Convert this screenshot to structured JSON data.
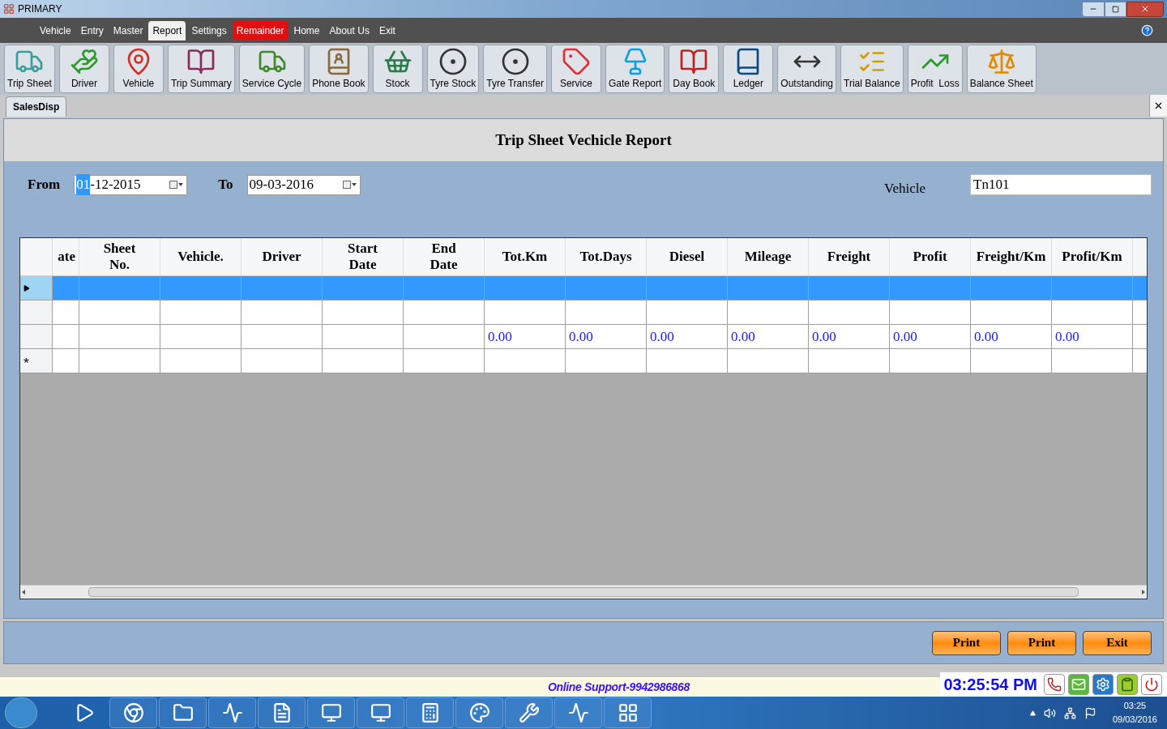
{
  "window": {
    "title": "PRIMARY"
  },
  "menu": [
    {
      "label": "Vehicle",
      "selected": false,
      "kind": "normal"
    },
    {
      "label": "Entry",
      "selected": false,
      "kind": "normal"
    },
    {
      "label": "Master",
      "selected": false,
      "kind": "normal"
    },
    {
      "label": "Report",
      "selected": true,
      "kind": "normal"
    },
    {
      "label": "Settings",
      "selected": false,
      "kind": "normal"
    },
    {
      "label": "Remainder",
      "selected": false,
      "kind": "alert"
    },
    {
      "label": "Home",
      "selected": false,
      "kind": "normal"
    },
    {
      "label": "About Us",
      "selected": false,
      "kind": "normal"
    },
    {
      "label": "Exit",
      "selected": false,
      "kind": "normal"
    }
  ],
  "toolbar": [
    "Trip Sheet",
    "Driver",
    "Vehicle",
    "Trip Summary",
    "Service Cycle",
    "Phone Book",
    "Stock",
    "Tyre Stock",
    "Tyre Transfer",
    "Service",
    "Gate Report",
    "Day Book",
    "Ledger",
    "Outstanding",
    "Trial Balance",
    "Profit  Loss",
    "Balance Sheet"
  ],
  "tabs": [
    {
      "label": "SalesDisp",
      "selected": true
    }
  ],
  "report": {
    "title": "Trip Sheet Vechicle Report",
    "from": {
      "label": "From",
      "selection": "01",
      "rest": "-12-2015"
    },
    "to": {
      "label": "To",
      "value": "09-03-2016"
    },
    "vehicle": {
      "label": "Vehicle",
      "value": "Tn101"
    }
  },
  "table": {
    "columns": [
      "ate",
      "Sheet No.",
      "Vehicle.",
      "Driver",
      "Start Date",
      "End Date",
      "Tot.Km",
      "Tot.Days",
      "Diesel",
      "Mileage",
      "Freight",
      "Profit",
      "Freight/Km",
      "Profit/Km"
    ],
    "rows": [
      {
        "selected": true,
        "current": true,
        "cells": [
          null,
          null,
          null,
          null,
          null,
          null,
          null,
          null,
          null,
          null,
          null,
          null,
          null,
          null
        ]
      },
      {
        "selected": false,
        "current": false,
        "cells": [
          null,
          null,
          null,
          null,
          null,
          null,
          null,
          null,
          null,
          null,
          null,
          null,
          null,
          null
        ]
      },
      {
        "selected": false,
        "current": false,
        "cells": [
          null,
          null,
          null,
          null,
          null,
          null,
          "0.00",
          "0.00",
          "0.00",
          "0.00",
          "0.00",
          "0.00",
          "0.00",
          "0.00"
        ]
      },
      {
        "selected": false,
        "current": false,
        "mark": "*",
        "cells": [
          null,
          null,
          null,
          null,
          null,
          null,
          null,
          null,
          null,
          null,
          null,
          null,
          null,
          null
        ]
      }
    ]
  },
  "buttons": [
    "Print",
    "Print",
    "Exit"
  ],
  "status": {
    "support": "Online Support-9942986868",
    "clock": "03:25:54 PM"
  },
  "taskbar": {
    "time": "03:25",
    "date": "09/03/2016"
  }
}
